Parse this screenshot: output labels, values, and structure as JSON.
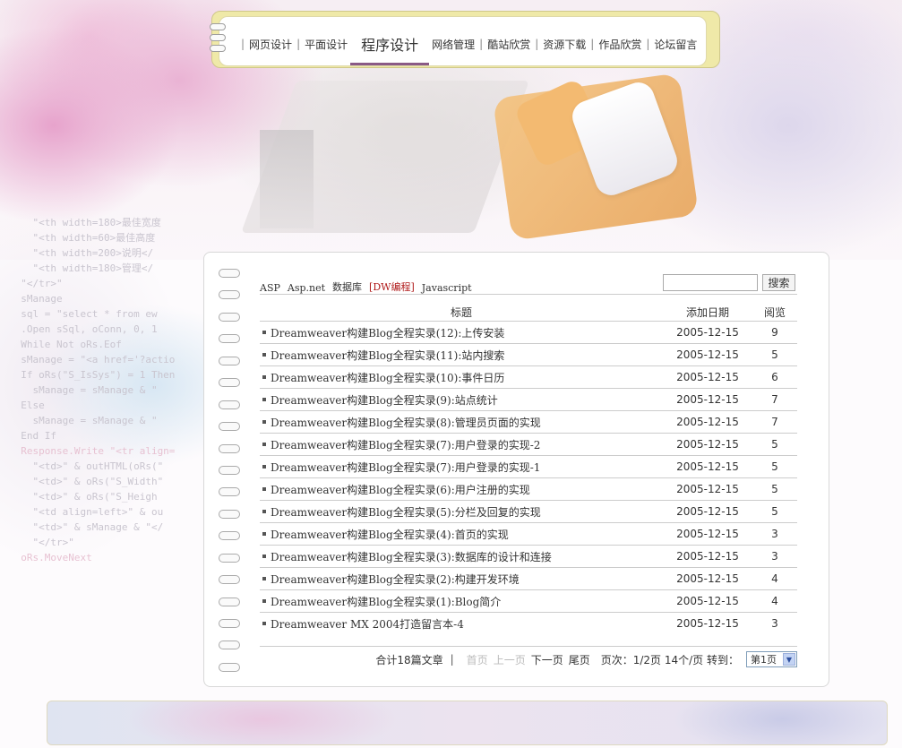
{
  "nav": {
    "items": [
      {
        "label": "网页设计",
        "active": false
      },
      {
        "label": "平面设计",
        "active": false
      },
      {
        "label": "程序设计",
        "active": true
      },
      {
        "label": "网络管理",
        "active": false
      },
      {
        "label": "酷站欣赏",
        "active": false
      },
      {
        "label": "资源下载",
        "active": false
      },
      {
        "label": "作品欣赏",
        "active": false
      },
      {
        "label": "论坛留言",
        "active": false
      }
    ]
  },
  "categories": [
    {
      "label": "ASP",
      "active": false
    },
    {
      "label": "Asp.net",
      "active": false
    },
    {
      "label": "数据库",
      "active": false
    },
    {
      "label": "[DW编程]",
      "active": true
    },
    {
      "label": "Javascript",
      "active": false
    }
  ],
  "search": {
    "value": "",
    "button_label": "搜索"
  },
  "table": {
    "headers": {
      "title": "标题",
      "date": "添加日期",
      "views": "阅览"
    },
    "rows": [
      {
        "title": "Dreamweaver构建Blog全程实录(12):上传安装",
        "date": "2005-12-15",
        "views": "9"
      },
      {
        "title": "Dreamweaver构建Blog全程实录(11):站内搜索",
        "date": "2005-12-15",
        "views": "5"
      },
      {
        "title": "Dreamweaver构建Blog全程实录(10):事件日历",
        "date": "2005-12-15",
        "views": "6"
      },
      {
        "title": "Dreamweaver构建Blog全程实录(9):站点统计",
        "date": "2005-12-15",
        "views": "7"
      },
      {
        "title": "Dreamweaver构建Blog全程实录(8):管理员页面的实现",
        "date": "2005-12-15",
        "views": "7"
      },
      {
        "title": "Dreamweaver构建Blog全程实录(7):用户登录的实现-2",
        "date": "2005-12-15",
        "views": "5"
      },
      {
        "title": "Dreamweaver构建Blog全程实录(7):用户登录的实现-1",
        "date": "2005-12-15",
        "views": "5"
      },
      {
        "title": "Dreamweaver构建Blog全程实录(6):用户注册的实现",
        "date": "2005-12-15",
        "views": "5"
      },
      {
        "title": "Dreamweaver构建Blog全程实录(5):分栏及回复的实现",
        "date": "2005-12-15",
        "views": "5"
      },
      {
        "title": "Dreamweaver构建Blog全程实录(4):首页的实现",
        "date": "2005-12-15",
        "views": "3"
      },
      {
        "title": "Dreamweaver构建Blog全程实录(3):数据库的设计和连接",
        "date": "2005-12-15",
        "views": "3"
      },
      {
        "title": "Dreamweaver构建Blog全程实录(2):构建开发环境",
        "date": "2005-12-15",
        "views": "4"
      },
      {
        "title": "Dreamweaver构建Blog全程实录(1):Blog简介",
        "date": "2005-12-15",
        "views": "4"
      },
      {
        "title": "Dreamweaver MX 2004打造留言本-4",
        "date": "2005-12-15",
        "views": "3"
      }
    ]
  },
  "pager": {
    "total": "合计18篇文章",
    "separator": "|",
    "first": "首页",
    "prev": "上一页",
    "next": "下一页",
    "last": "尾页",
    "info": "页次：1/2页 14个/页 转到：",
    "select_value": "第1页"
  },
  "background_code": [
    "    \"<th width=180>最佳宽度",
    "    \"<th width=60>最佳高度",
    "    \"<th width=200>说明</",
    "    \"<th width=180>管理</",
    "  \"</tr>\"",
    "",
    "  sManage",
    "  sql = \"select * from ew",
    "  .Open sSql, oConn, 0, 1",
    "  While Not oRs.Eof",
    "  sManage = \"<a href='?actio",
    "  If oRs(\"S_IsSys\") = 1 Then",
    "    sManage = sManage & \"",
    "  Else",
    "    sManage = sManage & \"",
    "  End If",
    "  Response.Write \"<tr align=",
    "    \"<td>\" & outHTML(oRs(\"",
    "    \"<td>\" & oRs(\"S_Width\"",
    "    \"<td>\" & oRs(\"S_Heigh",
    "    \"<td align=left>\" & ou",
    "    \"<td>\" & sManage & \"</",
    "    \"</tr>\"",
    "  oRs.MoveNext"
  ]
}
